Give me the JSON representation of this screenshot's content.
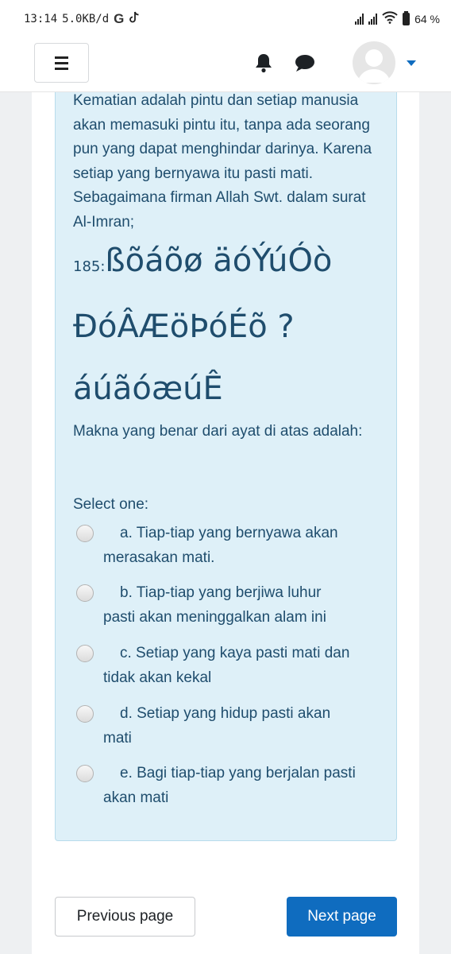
{
  "status_bar": {
    "time": "13:14",
    "speed": "5.0KB/d",
    "g_label": "G",
    "battery": "64 %"
  },
  "navbar": {
    "menu_icon": "hamburger-icon",
    "notifications_icon": "bell-icon",
    "messages_icon": "chat-bubble-icon",
    "user_icon": "avatar-icon",
    "dropdown_icon": "caret-down-icon"
  },
  "question": {
    "text": "Kematian adalah pintu dan setiap manusia akan memasuki pintu itu, tanpa ada seorang pun yang dapat menghindar darinya. Karena setiap yang bernyawa itu pasti mati. Sebagaimana firman Allah Swt. dalam surat Al-Imran;",
    "verse_number": "185:",
    "verse_line1": "ßõáõø äóÝúÓò",
    "verse_line2": "ÐóÂÆöÞóÉõ ?",
    "verse_line3": "áúãóæúÊ",
    "prompt": "Makna yang benar dari ayat di atas adalah:",
    "select_label": "Select one:",
    "options": [
      {
        "first": "a. Tiap-tiap yang bernyawa akan",
        "second": "merasakan mati."
      },
      {
        "first": "b. Tiap-tiap yang berjiwa luhur",
        "second": "pasti akan meninggalkan alam ini"
      },
      {
        "first": "c. Setiap yang kaya pasti mati dan",
        "second": "tidak akan kekal"
      },
      {
        "first": "d. Setiap yang hidup pasti akan",
        "second": "mati"
      },
      {
        "first": "e. Bagi tiap-tiap yang berjalan pasti",
        "second": "akan mati"
      }
    ]
  },
  "footer": {
    "previous": "Previous page",
    "next": "Next page"
  },
  "colors": {
    "accent": "#0f6cbf",
    "question_bg": "#def0f8",
    "question_text": "#1f4d6d"
  }
}
